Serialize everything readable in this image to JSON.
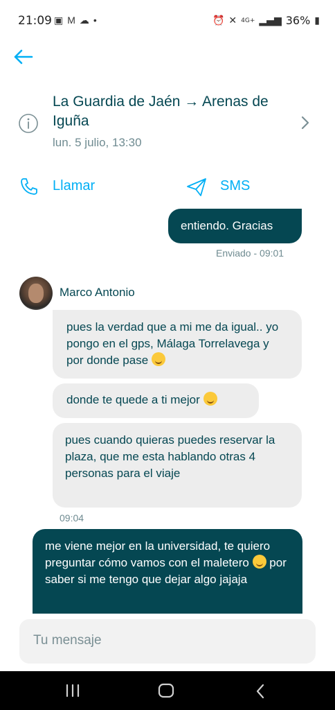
{
  "status_bar": {
    "time": "21:09",
    "network": "4G+",
    "battery": "36%"
  },
  "header": {
    "trip_title": "La Guardia de Jaén → Arenas de Iguña",
    "trip_date": "lun. 5 julio, 13:30"
  },
  "actions": {
    "call_label": "Llamar",
    "sms_label": "SMS"
  },
  "messages": [
    {
      "direction": "out",
      "text": "entiendo. Gracias",
      "meta": "Enviado - 09:01"
    },
    {
      "direction": "in",
      "sender": "Marco Antonio",
      "text": "pues la verdad que a mi me da igual.. yo pongo en el gps, Málaga Torrelavega y por donde pase"
    },
    {
      "direction": "in",
      "text": "donde te quede a ti mejor"
    },
    {
      "direction": "in",
      "text": "pues cuando quieras puedes reservar la plaza, que me esta hablando otras 4 personas para el viaje",
      "meta": "09:04"
    },
    {
      "direction": "out",
      "text": "me viene mejor en la universidad, te quiero preguntar cómo vamos con el maletero",
      "text_after": "por saber si me tengo que dejar algo jajaja"
    }
  ],
  "composer": {
    "placeholder": "Tu mensaje"
  },
  "colors": {
    "brand_dark": "#054752",
    "accent_blue": "#00aff5",
    "incoming_bubble": "#ededed"
  }
}
